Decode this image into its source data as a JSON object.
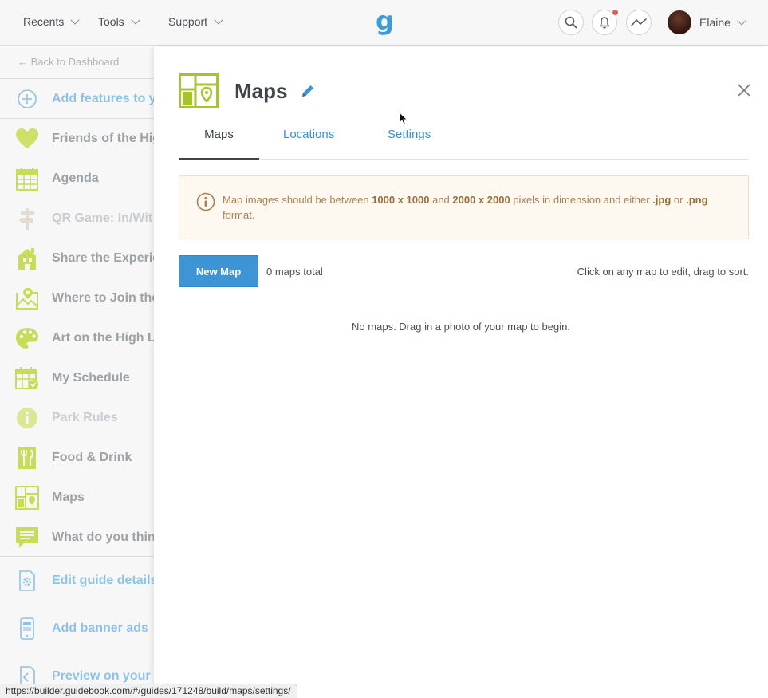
{
  "topnav": {
    "recents": "Recents",
    "tools": "Tools",
    "support": "Support",
    "logo": "g",
    "user_name": "Elaine"
  },
  "sidebar": {
    "back_label": "← Back to Dashboard",
    "items": [
      {
        "label": "Add features to y",
        "icon": "plus-circle-icon"
      },
      {
        "label": "Friends of the Hig",
        "icon": "heart-icon"
      },
      {
        "label": "Agenda",
        "icon": "calendar-icon"
      },
      {
        "label": "QR Game: In/Wit",
        "icon": "signpost-icon"
      },
      {
        "label": "Share the Experie",
        "icon": "building-icon"
      },
      {
        "label": "Where to Join the",
        "icon": "map-pin-icon"
      },
      {
        "label": "Art on the High Li",
        "icon": "palette-icon"
      },
      {
        "label": "My Schedule",
        "icon": "calendar-check-icon"
      },
      {
        "label": "Park Rules",
        "icon": "info-icon"
      },
      {
        "label": "Food & Drink",
        "icon": "utensils-icon"
      },
      {
        "label": "Maps",
        "icon": "map-icon"
      },
      {
        "label": "What do you thin",
        "icon": "comment-icon"
      },
      {
        "label": "Edit guide details",
        "icon": "gear-icon"
      },
      {
        "label": "Add banner ads",
        "icon": "phone-icon"
      },
      {
        "label": "Preview on your d",
        "icon": "preview-icon"
      }
    ]
  },
  "panel": {
    "title": "Maps",
    "tabs": [
      "Maps",
      "Locations",
      "Settings"
    ],
    "notice": {
      "t1": "Map images should be between ",
      "b1": "1000 x 1000",
      "t2": " and ",
      "b2": "2000 x 2000",
      "t3": " pixels in dimension and either ",
      "b3": ".jpg",
      "t4": " or ",
      "b4": ".png",
      "t5": " format."
    },
    "new_map_label": "New Map",
    "maps_total": "0 maps total",
    "hint": "Click on any map to edit, drag to sort.",
    "empty_message": "No maps. Drag in a photo of your map to begin."
  },
  "status_url": "https://builder.guidebook.com/#/guides/171248/build/maps/settings/",
  "colors": {
    "accent": "#3d95d6",
    "icon_green": "#c8dc5a",
    "notice_bg": "#fdf8f0"
  }
}
